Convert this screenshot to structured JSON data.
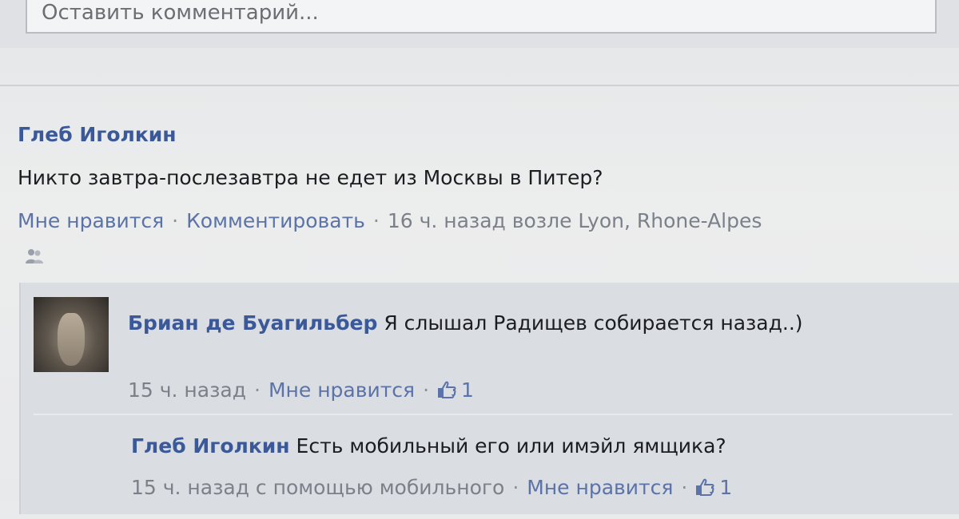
{
  "comment_box": {
    "placeholder": "Оставить комментарий..."
  },
  "post": {
    "author": "Глеб Иголкин",
    "text": "Никто завтра-послезавтра не едет из Москвы в Питер?",
    "actions": {
      "like": "Мне нравится",
      "comment": "Комментировать",
      "meta": "16 ч. назад возле Lyon, Rhone-Alpes"
    },
    "audience_icon": "friends-icon"
  },
  "replies": [
    {
      "author": "Бриан де Буагильбер",
      "text": "Я слышал Радищев собирается назад..)",
      "time": "15 ч. назад",
      "like": "Мне нравится",
      "like_count": "1",
      "avatar_icon": "avatar"
    },
    {
      "author": "Глеб Иголкин",
      "text": "Есть мобильный его или имэйл ямщика?",
      "time": "15 ч. назад с помощью мобильного",
      "like": "Мне нравится",
      "like_count": "1"
    }
  ],
  "separator": "·",
  "colors": {
    "link": "#3b5998",
    "meta": "#7b8089",
    "background": "#e9eaec"
  }
}
